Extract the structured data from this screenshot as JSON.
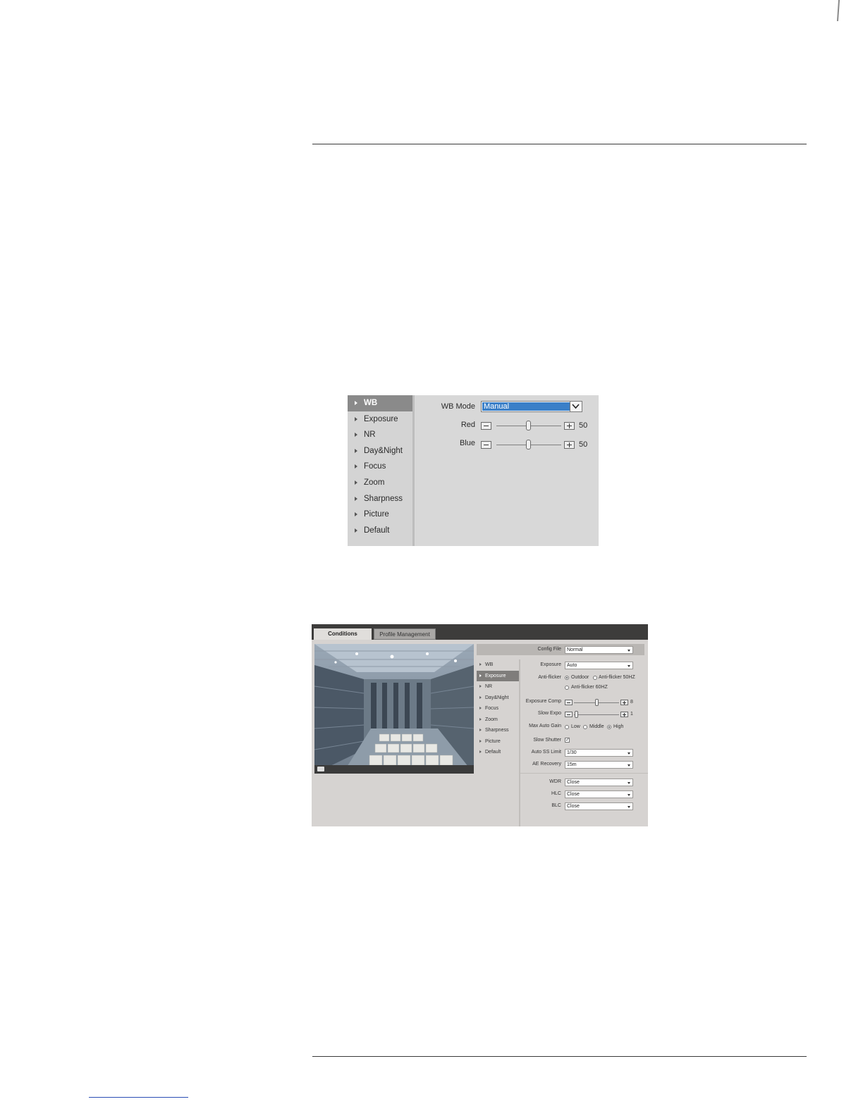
{
  "figure_wb": {
    "menu": [
      {
        "label": "WB",
        "active": true
      },
      {
        "label": "Exposure",
        "active": false
      },
      {
        "label": "NR",
        "active": false
      },
      {
        "label": "Day&Night",
        "active": false
      },
      {
        "label": "Focus",
        "active": false
      },
      {
        "label": "Zoom",
        "active": false
      },
      {
        "label": "Sharpness",
        "active": false
      },
      {
        "label": "Picture",
        "active": false
      },
      {
        "label": "Default",
        "active": false
      }
    ],
    "wb_mode_label": "WB Mode",
    "wb_mode_value": "Manual",
    "red_label": "Red",
    "red_value": "50",
    "blue_label": "Blue",
    "blue_value": "50"
  },
  "figure_conditions": {
    "tabs": [
      "Conditions",
      "Profile Management"
    ],
    "config_file_label": "Config File",
    "config_file_value": "Normal",
    "menu": [
      {
        "label": "WB",
        "active": false
      },
      {
        "label": "Exposure",
        "active": true
      },
      {
        "label": "NR",
        "active": false
      },
      {
        "label": "Day&Night",
        "active": false
      },
      {
        "label": "Focus",
        "active": false
      },
      {
        "label": "Zoom",
        "active": false
      },
      {
        "label": "Sharpness",
        "active": false
      },
      {
        "label": "Picture",
        "active": false
      },
      {
        "label": "Default",
        "active": false
      }
    ],
    "exposure_label": "Exposure",
    "exposure_value": "Auto",
    "anti_flicker_label": "Anti-flicker",
    "anti_flicker_options": [
      "Outdoor",
      "Anti-flicker 50HZ",
      "Anti-flicker 60HZ"
    ],
    "anti_flicker_selected": "Outdoor",
    "exposure_comp_label": "Exposure Comp",
    "exposure_comp_value": "8",
    "slow_expo_label": "Slow Expo",
    "slow_expo_value": "1",
    "max_auto_gain_label": "Max Auto Gain",
    "max_auto_gain_options": [
      "Low",
      "Middle",
      "High"
    ],
    "max_auto_gain_selected": "High",
    "slow_shutter_label": "Slow Shutter",
    "slow_shutter_checked": "✓",
    "auto_ss_limit_label": "Auto SS Limit",
    "auto_ss_limit_value": "1/30",
    "ae_recovery_label": "AE Recovery",
    "ae_recovery_value": "15m",
    "wdr_label": "WDR",
    "wdr_value": "Close",
    "hlc_label": "HLC",
    "hlc_value": "Close",
    "blc_label": "BLC",
    "blc_value": "Close"
  }
}
